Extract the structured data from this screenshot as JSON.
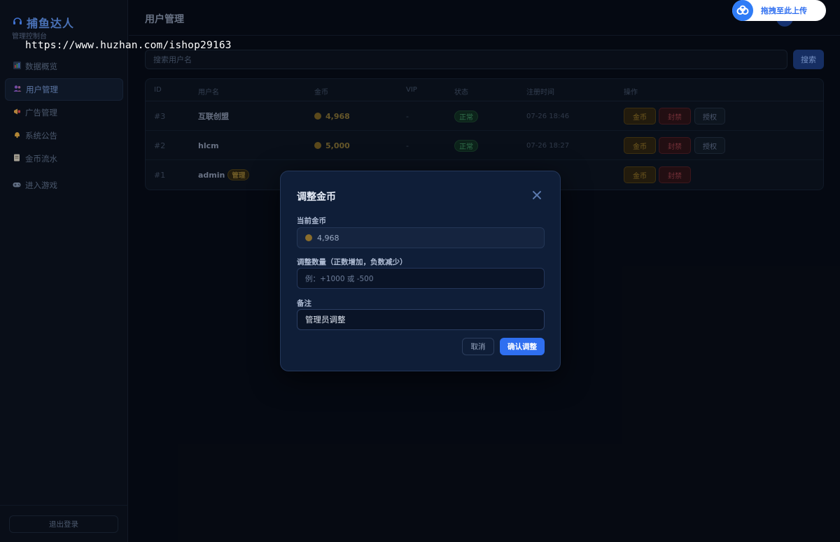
{
  "sidebar": {
    "brand_title": "捕鱼达人",
    "brand_subtitle": "管理控制台",
    "items": [
      {
        "label": "数据概览",
        "icon": "bar-chart-icon",
        "active": false
      },
      {
        "label": "用户管理",
        "icon": "users-icon",
        "active": true
      },
      {
        "label": "广告管理",
        "icon": "megaphone-icon",
        "active": false
      },
      {
        "label": "系统公告",
        "icon": "bell-icon",
        "active": false
      },
      {
        "label": "金币流水",
        "icon": "ledger-icon",
        "active": false
      },
      {
        "label": "进入游戏",
        "icon": "gamepad-icon",
        "active": false
      }
    ],
    "logout_label": "退出登录"
  },
  "header": {
    "title": "用户管理"
  },
  "search": {
    "placeholder": "搜索用户名",
    "button_label": "搜索"
  },
  "table": {
    "columns": [
      "ID",
      "用户名",
      "金币",
      "VIP",
      "状态",
      "注册时间",
      "操作"
    ],
    "rows": [
      {
        "id": "#3",
        "username": "互联创盟",
        "coins": "4,968",
        "vip": "-",
        "status": "正常",
        "registered": "07-26 18:46",
        "actions": [
          "金币",
          "封禁",
          "授权"
        ]
      },
      {
        "id": "#2",
        "username": "hlcm",
        "coins": "5,000",
        "vip": "-",
        "status": "正常",
        "registered": "07-26 18:27",
        "actions": [
          "金币",
          "封禁",
          "授权"
        ]
      },
      {
        "id": "#1",
        "username": "admin",
        "admin_badge": "管理",
        "actions": [
          "金币",
          "封禁"
        ]
      }
    ]
  },
  "modal": {
    "title": "调整金币",
    "current_label": "当前金币",
    "current_value": "4,968",
    "amount_label": "调整数量（正数增加，负数减少）",
    "amount_placeholder": "例：+1000 或 -500",
    "note_label": "备注",
    "note_value": "管理员调整",
    "cancel_label": "取消",
    "confirm_label": "确认调整"
  },
  "watermark": "https://www.huzhan.com/ishop29163",
  "upload_widget": {
    "label": "拖拽至此上传"
  },
  "colors": {
    "accent": "#2f6ff0",
    "background": "#070c16",
    "modal_bg": "#0f1e38",
    "success": "#3c8a5e",
    "danger": "#8f3b45",
    "gold": "#8c6f26"
  }
}
